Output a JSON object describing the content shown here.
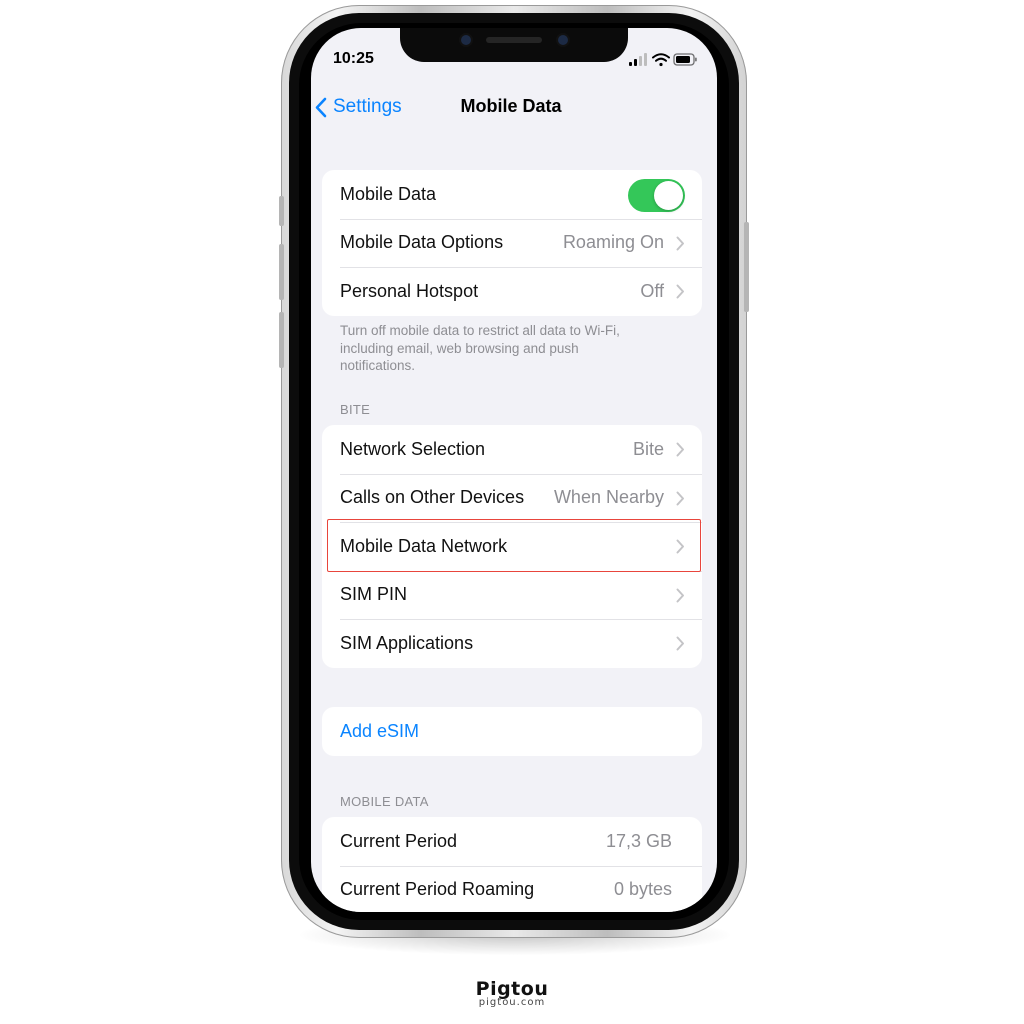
{
  "status_bar": {
    "time": "10:25"
  },
  "nav": {
    "back_label": "Settings",
    "title": "Mobile Data"
  },
  "group_main": {
    "mobile_data": {
      "label": "Mobile Data",
      "enabled": true
    },
    "options": {
      "label": "Mobile Data Options",
      "value": "Roaming On"
    },
    "hotspot": {
      "label": "Personal Hotspot",
      "value": "Off"
    }
  },
  "footnote": "Turn off mobile data to restrict all data to Wi-Fi, including email, web browsing and push notifications.",
  "carrier_header": "BITE",
  "carrier_group": {
    "network_selection": {
      "label": "Network Selection",
      "value": "Bite"
    },
    "calls_other": {
      "label": "Calls on Other Devices",
      "value": "When Nearby"
    },
    "data_network": {
      "label": "Mobile Data Network"
    },
    "sim_pin": {
      "label": "SIM PIN"
    },
    "sim_apps": {
      "label": "SIM Applications"
    }
  },
  "esim": {
    "label": "Add eSIM"
  },
  "usage_header": "MOBILE DATA",
  "usage_group": {
    "current_period": {
      "label": "Current Period",
      "value": "17,3 GB"
    },
    "current_roaming": {
      "label": "Current Period Roaming",
      "value": "0 bytes"
    }
  },
  "brand": {
    "name": "Pigtou",
    "url": "pigtou.com"
  },
  "colors": {
    "accent": "#0a84ff",
    "toggle_on": "#34c759",
    "highlight": "#e8453c",
    "background": "#f2f2f7"
  }
}
